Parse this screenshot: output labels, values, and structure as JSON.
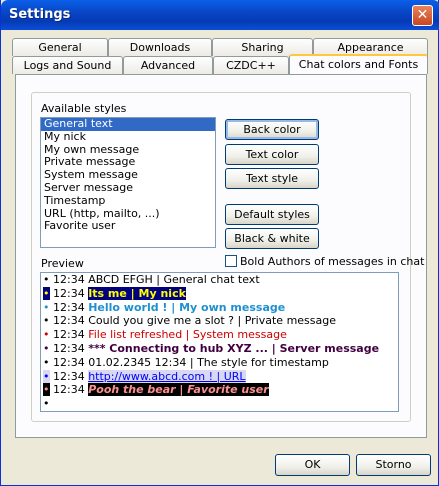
{
  "window": {
    "title": "Settings",
    "close_glyph": "✕"
  },
  "tabs_row1": [
    {
      "label": "General"
    },
    {
      "label": "Downloads"
    },
    {
      "label": "Sharing"
    },
    {
      "label": "Appearance"
    }
  ],
  "tabs_row2": [
    {
      "label": "Logs and Sound"
    },
    {
      "label": "Advanced"
    },
    {
      "label": "CZDC++"
    },
    {
      "label": "Chat colors and Fonts"
    }
  ],
  "styles": {
    "label": "Available styles",
    "items": [
      "General text",
      "My nick",
      "My own message",
      "Private message",
      "System message",
      "Server message",
      "Timestamp",
      "URL (http, mailto, ...)",
      "Favorite user"
    ],
    "selected": "General text"
  },
  "buttons": {
    "back_color": "Back color",
    "text_color": "Text color",
    "text_style": "Text style",
    "default_styles": "Default styles",
    "black_white": "Black & white"
  },
  "bold_authors": {
    "label": "Bold Authors of messages in chat",
    "checked": false
  },
  "preview": {
    "label": "Preview",
    "lines": [
      {
        "bullet": "•",
        "time": "12:34",
        "text": "ABCD EFGH | General chat text",
        "color": "#000000",
        "bg": "",
        "bold": false,
        "italic": false,
        "underline": false
      },
      {
        "bullet": "•",
        "time": "12:34",
        "text": "Its me | My nick",
        "color": "#ffff00",
        "bg": "#000080",
        "bold": true,
        "italic": false,
        "underline": false
      },
      {
        "bullet": "•",
        "time": "12:34",
        "text": "Hello world ! | My own message",
        "color": "#1e90d0",
        "bg": "",
        "bold": true,
        "italic": false,
        "underline": false
      },
      {
        "bullet": "•",
        "time": "12:34",
        "text": "Could you give me a slot ? | Private message",
        "color": "#000000",
        "bg": "",
        "bold": false,
        "italic": false,
        "underline": false
      },
      {
        "bullet": "•",
        "time": "12:34",
        "text": "File list refreshed | System message",
        "color": "#cc0000",
        "bg": "",
        "bold": false,
        "italic": false,
        "underline": false
      },
      {
        "bullet": "•",
        "time": "12:34",
        "text": "*** Connecting to hub XYZ ... | Server message",
        "color": "#400040",
        "bg": "",
        "bold": true,
        "italic": false,
        "underline": false
      },
      {
        "bullet": "•",
        "time": "12:34",
        "text": "01.02.2345 12:34 | The style for timestamp",
        "color": "#000000",
        "bg": "",
        "bold": false,
        "italic": false,
        "underline": false
      },
      {
        "bullet": "•",
        "time": "12:34",
        "text": "http://www.abcd.com ! | URL",
        "color": "#0000ff",
        "bg": "#d8d8f0",
        "bold": false,
        "italic": false,
        "underline": true
      },
      {
        "bullet": "•",
        "time": "12:34",
        "text": "Pooh the bear | Favorite user",
        "color": "#ff9090",
        "bg": "#000000",
        "bold": true,
        "italic": true,
        "underline": false
      },
      {
        "bullet": "•",
        "time": "",
        "text": "",
        "color": "#000000",
        "bg": "",
        "bold": false,
        "italic": false,
        "underline": false
      }
    ]
  },
  "dialog": {
    "ok": "OK",
    "cancel": "Storno"
  }
}
